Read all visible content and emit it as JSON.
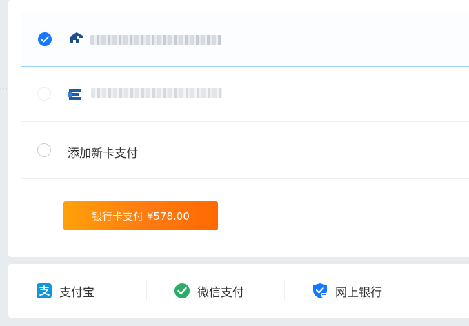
{
  "payment_options": {
    "option1_masked_label": "",
    "option2_masked_label": "",
    "add_card_label": "添加新卡支付"
  },
  "pay_button": {
    "label": "银行卡支付 ¥578.00"
  },
  "methods": [
    {
      "label": "支付宝",
      "icon": "alipay-icon"
    },
    {
      "label": "微信支付",
      "icon": "wechat-pay-icon"
    },
    {
      "label": "网上银行",
      "icon": "online-bank-icon"
    }
  ],
  "colors": {
    "accent_blue": "#1677ff",
    "button_orange_start": "#ffa10a",
    "button_orange_end": "#ff6a00",
    "alipay_blue": "#1296db",
    "wechat_green": "#2aae67"
  }
}
